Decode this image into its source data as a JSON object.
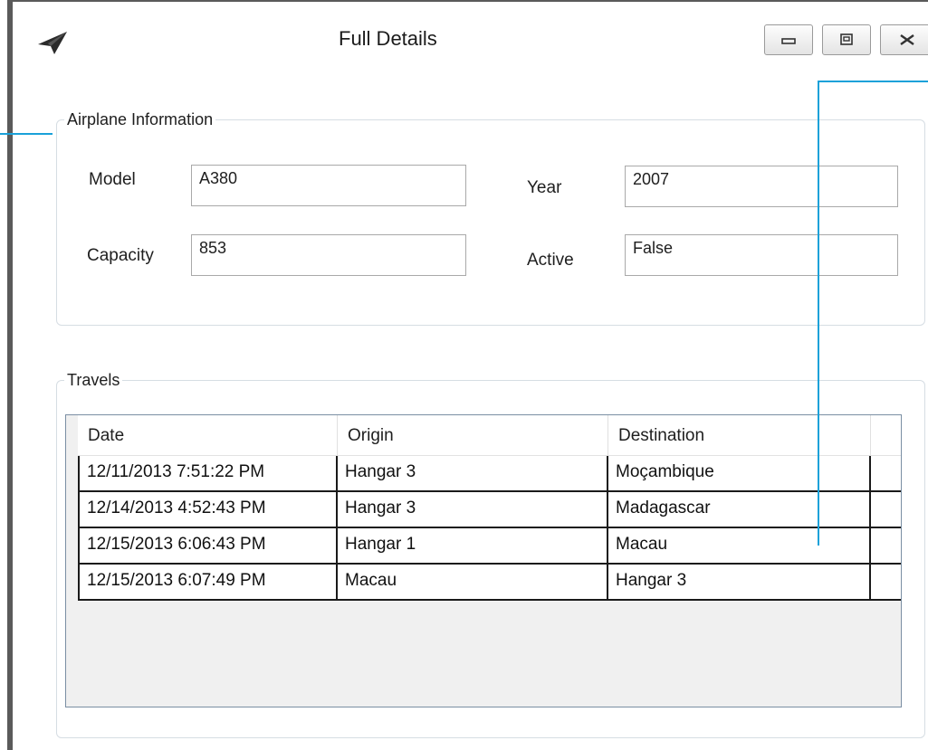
{
  "window": {
    "title": "Full Details",
    "icon": "paper-plane-icon",
    "controls": [
      "minimize-icon",
      "maximize-icon",
      "close-icon"
    ]
  },
  "airplane_info": {
    "legend": "Airplane Information",
    "model_label": "Model",
    "model_value": "A380",
    "year_label": "Year",
    "year_value": "2007",
    "capacity_label": "Capacity",
    "capacity_value": "853",
    "active_label": "Active",
    "active_value": "False"
  },
  "travels": {
    "legend": "Travels",
    "columns": [
      "Date",
      "Origin",
      "Destination"
    ],
    "rows": [
      [
        "12/11/2013 7:51:22 PM",
        "Hangar 3",
        "Moçambique"
      ],
      [
        "12/14/2013 4:52:43 PM",
        "Hangar 3",
        "Madagascar"
      ],
      [
        "12/15/2013 6:06:43 PM",
        "Hangar 1",
        "Macau"
      ],
      [
        "12/15/2013 6:07:49 PM",
        "Macau",
        "Hangar 3"
      ]
    ]
  },
  "colors": {
    "callout_line": "#1aa1d9",
    "group_border": "#d6dde3",
    "grid_border": "#7a8ea3",
    "grid_empty_bg": "#f0f0f0"
  }
}
